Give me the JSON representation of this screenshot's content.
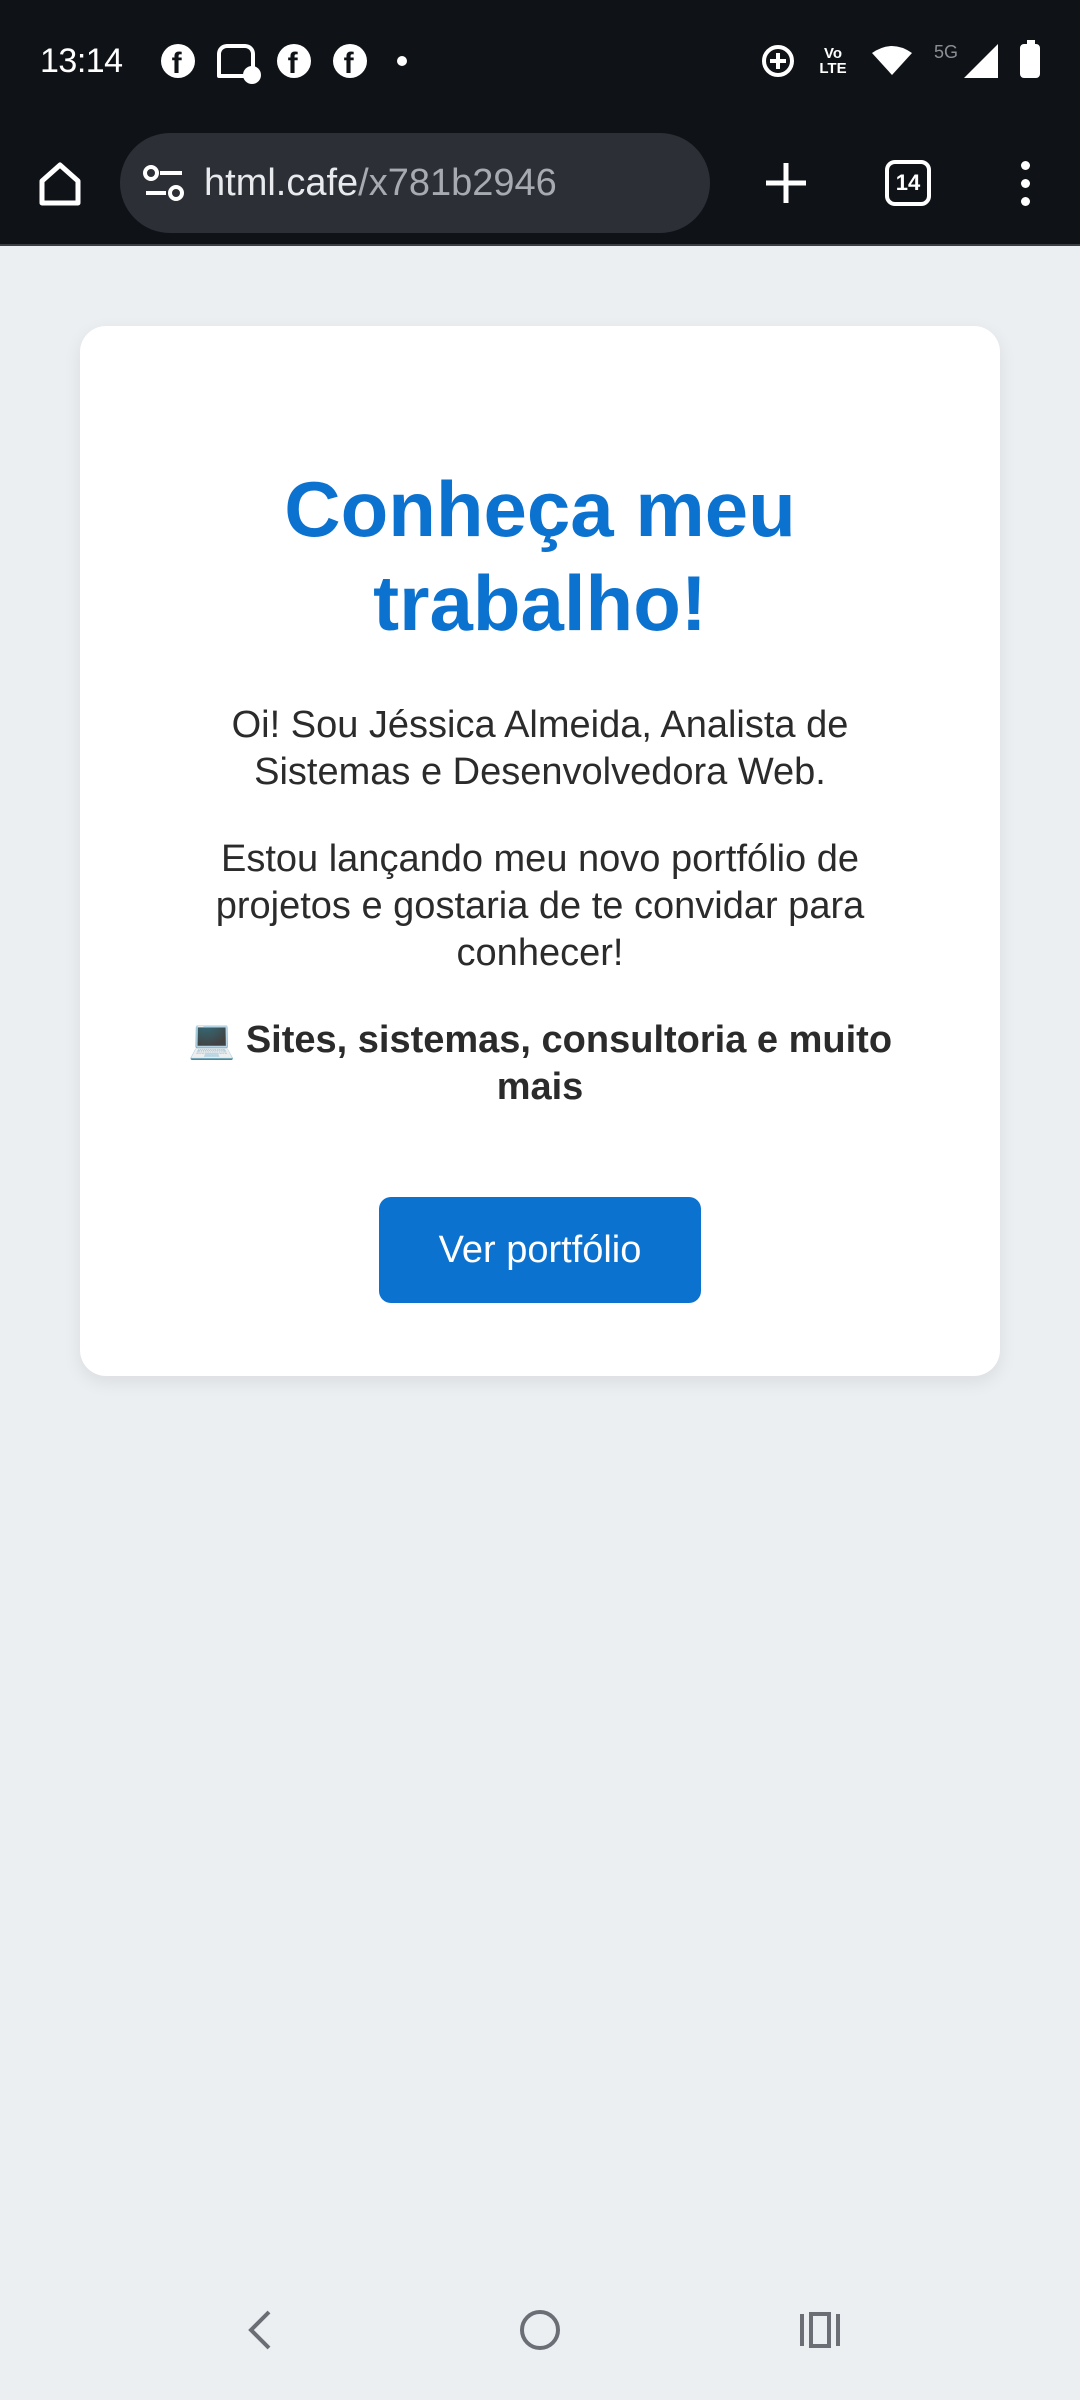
{
  "status_bar": {
    "time": "13:14",
    "network_badge": "5G",
    "volte_label": "Vo\nLTE"
  },
  "browser": {
    "url_host": "html.cafe",
    "url_path": "/x781b2946",
    "tab_count": "14"
  },
  "page": {
    "title": "Conheça meu trabalho!",
    "intro": "Oi! Sou Jéssica Almeida, Analista de Sistemas e Desenvolvedora Web.",
    "invite": "Estou lançando meu novo portfólio de projetos e gostaria de te convidar para conhecer!",
    "highlight": "💻 Sites, sistemas, consultoria e muito mais",
    "cta_label": "Ver portfólio"
  },
  "colors": {
    "accent": "#0b72cf",
    "page_background": "#eceff2",
    "status_bar": "#0f1318"
  }
}
